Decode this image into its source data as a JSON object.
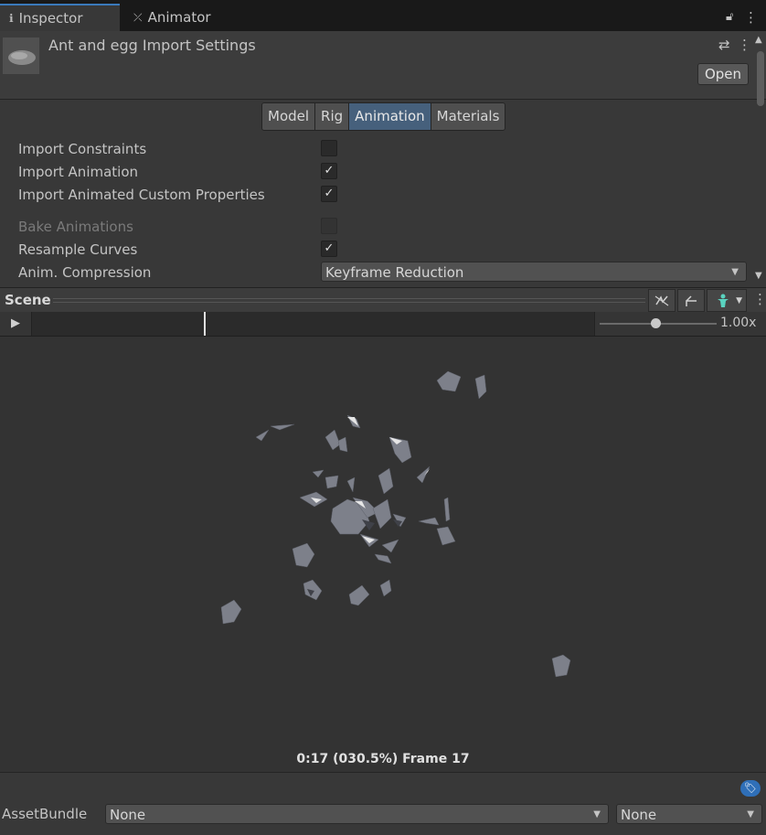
{
  "tabs": [
    {
      "label": "Inspector",
      "icon": "info-icon"
    },
    {
      "label": "Animator",
      "icon": "animator-icon"
    }
  ],
  "header": {
    "title": "Ant and egg Import Settings",
    "open_label": "Open"
  },
  "import_tabs": [
    "Model",
    "Rig",
    "Animation",
    "Materials"
  ],
  "active_import_tab": "Animation",
  "properties": {
    "import_constraints": {
      "label": "Import Constraints",
      "checked": false
    },
    "import_animation": {
      "label": "Import Animation",
      "checked": true,
      "check": "✓"
    },
    "import_animated_custom": {
      "label": "Import Animated Custom Properties",
      "checked": true,
      "check": "✓"
    },
    "bake_animations": {
      "label": "Bake Animations",
      "checked": false,
      "disabled": true
    },
    "resample_curves": {
      "label": "Resample Curves",
      "checked": true,
      "check": "✓"
    },
    "anim_compression": {
      "label": "Anim. Compression",
      "value": "Keyframe Reduction"
    }
  },
  "scene": {
    "title": "Scene",
    "speed": "1.00x",
    "frame_label": "0:17 (030.5%) Frame 17"
  },
  "footer": {
    "assetbundle_label": "AssetBundle",
    "bundle_name": "None",
    "bundle_variant": "None"
  },
  "colors": {
    "accent": "#3a79bb",
    "active_tab": "#46607c",
    "background": "#383838",
    "viewport": "#333333"
  }
}
